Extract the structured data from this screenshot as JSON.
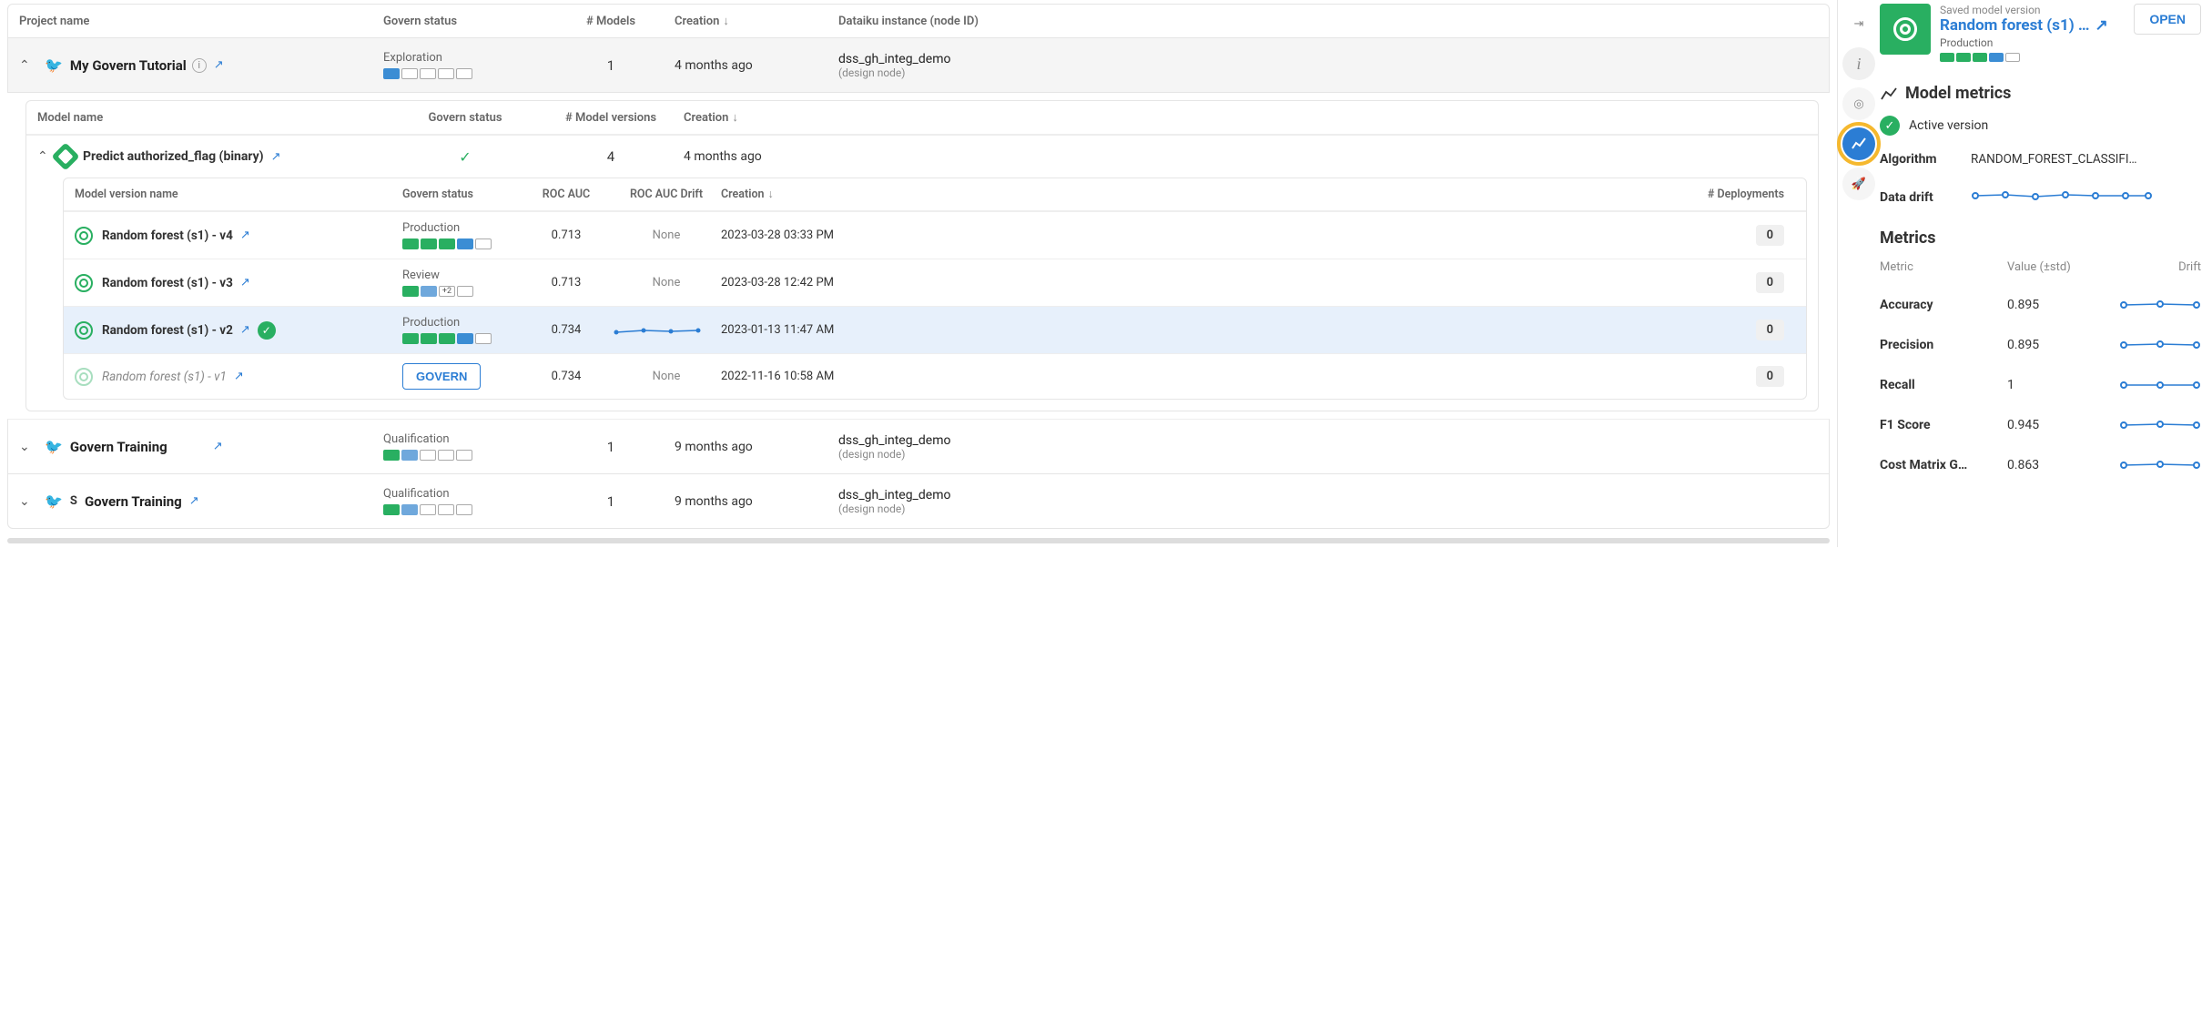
{
  "main": {
    "project_header": {
      "name": "Project name",
      "status": "Govern status",
      "models": "# Models",
      "creation": "Creation",
      "instance": "Dataiku instance (node ID)"
    },
    "projects": [
      {
        "name": "My Govern Tutorial",
        "status": "Exploration",
        "models": "1",
        "creation": "4 months ago",
        "instance": "dss_gh_integ_demo",
        "instance_sub": "(design node)",
        "expanded": true
      },
      {
        "name": "Govern Training",
        "status": "Qualification",
        "models": "1",
        "creation": "9 months ago",
        "instance": "dss_gh_integ_demo",
        "instance_sub": "(design node)",
        "prefix": ""
      },
      {
        "name": "Govern Training",
        "status": "Qualification",
        "models": "1",
        "creation": "9 months ago",
        "instance": "dss_gh_integ_demo",
        "instance_sub": "(design node)",
        "prefix": "S"
      }
    ],
    "model_header": {
      "name": "Model name",
      "status": "Govern status",
      "versions": "# Model versions",
      "creation": "Creation"
    },
    "model": {
      "name": "Predict authorized_flag (binary)",
      "versions": "4",
      "creation": "4 months ago"
    },
    "version_header": {
      "name": "Model version name",
      "status": "Govern status",
      "roc": "ROC AUC",
      "drift": "ROC AUC Drift",
      "creation": "Creation",
      "deploy": "# Deployments"
    },
    "versions": [
      {
        "name": "Random forest (s1) - v4",
        "status": "Production",
        "roc": "0.713",
        "drift": "None",
        "creation": "2023-03-28 03:33 PM",
        "deploy": "0"
      },
      {
        "name": "Random forest (s1) - v3",
        "status": "Review",
        "roc": "0.713",
        "drift": "None",
        "creation": "2023-03-28 12:42 PM",
        "deploy": "0",
        "plus": "+2"
      },
      {
        "name": "Random forest (s1) - v2",
        "status": "Production",
        "roc": "0.734",
        "drift": "spark",
        "creation": "2023-01-13 11:47 AM",
        "deploy": "0",
        "selected": true,
        "active": true
      },
      {
        "name": "Random forest (s1) - v1",
        "status": "GOVERN",
        "roc": "0.734",
        "drift": "None",
        "creation": "2022-11-16 10:58 AM",
        "deploy": "0",
        "govern_action": true,
        "dim": true
      }
    ]
  },
  "side": {
    "saved": "Saved model version",
    "title": "Random forest (s1) …",
    "subtitle": "Production",
    "open": "OPEN",
    "metrics_title": "Model metrics",
    "active_version": "Active version",
    "algorithm_label": "Algorithm",
    "algorithm_value": "RANDOM_FOREST_CLASSIFI…",
    "datadrift_label": "Data drift",
    "metrics_section": "Metrics",
    "metrics_header": {
      "metric": "Metric",
      "value": "Value (±std)",
      "drift": "Drift"
    },
    "metrics": [
      {
        "name": "Accuracy",
        "value": "0.895"
      },
      {
        "name": "Precision",
        "value": "0.895"
      },
      {
        "name": "Recall",
        "value": "1"
      },
      {
        "name": "F1 Score",
        "value": "0.945"
      },
      {
        "name": "Cost Matrix G…",
        "value": "0.863"
      }
    ]
  },
  "chart_data": [
    {
      "type": "line",
      "title": "ROC AUC Drift (v2)",
      "values": [
        0.72,
        0.73,
        0.73,
        0.73
      ],
      "ylim": [
        0.7,
        0.76
      ]
    },
    {
      "type": "line",
      "title": "Data drift",
      "values": [
        0.1,
        0.1,
        0.11,
        0.1,
        0.1,
        0.1,
        0.1
      ],
      "ylim": [
        0,
        0.3
      ]
    },
    {
      "type": "line",
      "title": "Accuracy drift",
      "values": [
        0.89,
        0.9,
        0.895
      ],
      "ylim": [
        0.85,
        0.95
      ]
    },
    {
      "type": "line",
      "title": "Precision drift",
      "values": [
        0.89,
        0.9,
        0.895
      ],
      "ylim": [
        0.85,
        0.95
      ]
    },
    {
      "type": "line",
      "title": "Recall drift",
      "values": [
        1,
        1,
        1
      ],
      "ylim": [
        0.9,
        1.05
      ]
    },
    {
      "type": "line",
      "title": "F1 Score drift",
      "values": [
        0.94,
        0.95,
        0.945
      ],
      "ylim": [
        0.9,
        1.0
      ]
    },
    {
      "type": "line",
      "title": "Cost Matrix drift",
      "values": [
        0.86,
        0.87,
        0.863
      ],
      "ylim": [
        0.8,
        0.9
      ]
    }
  ]
}
